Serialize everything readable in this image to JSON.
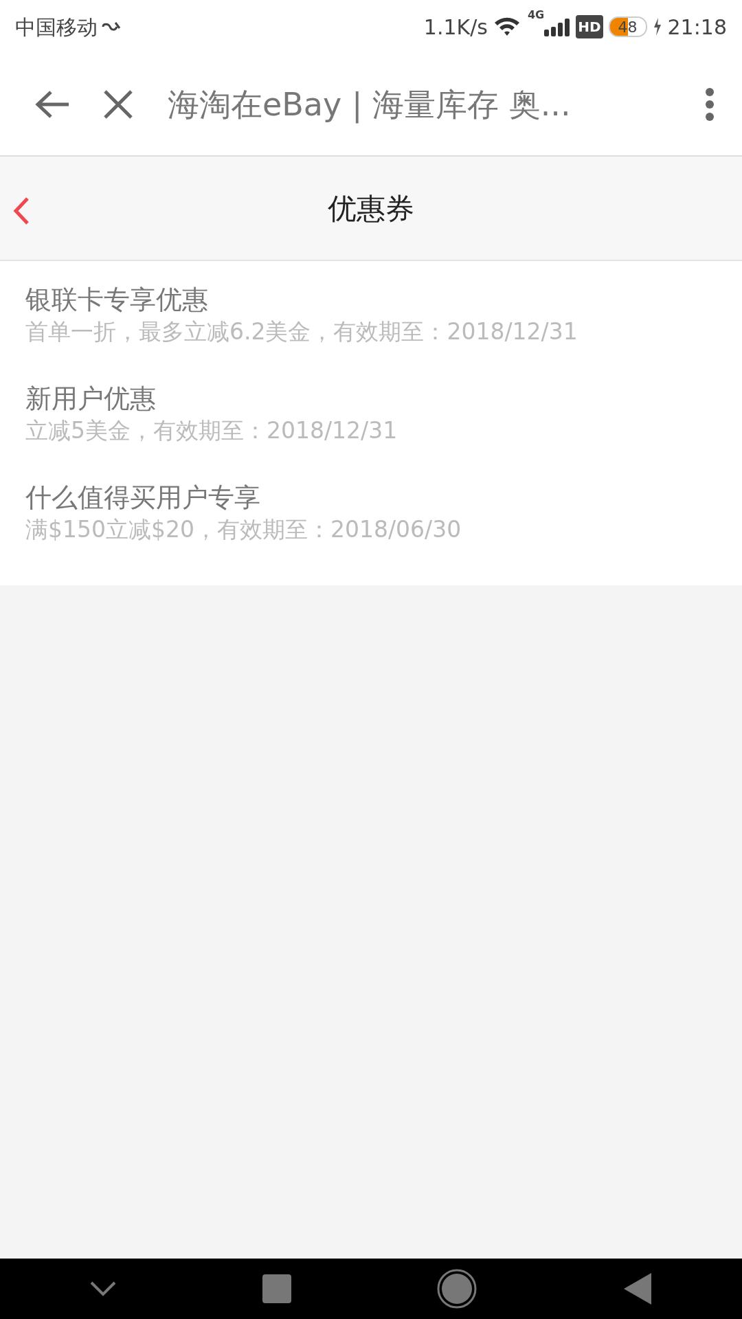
{
  "status_bar": {
    "carrier": "中国移动",
    "speed": "1.1K/s",
    "network": "4G",
    "hd": "HD",
    "battery": "48",
    "time": "21:18"
  },
  "toolbar": {
    "title": "海淘在eBay | 海量库存 奥..."
  },
  "header": {
    "title": "优惠券"
  },
  "coupons": [
    {
      "title": "银联卡专享优惠",
      "detail": "首单一折，最多立减6.2美金，有效期至：2018/12/31"
    },
    {
      "title": "新用户优惠",
      "detail": "立减5美金，有效期至：2018/12/31"
    },
    {
      "title": "什么值得买用户专享",
      "detail": "满$150立减$20，有效期至：2018/06/30"
    }
  ]
}
